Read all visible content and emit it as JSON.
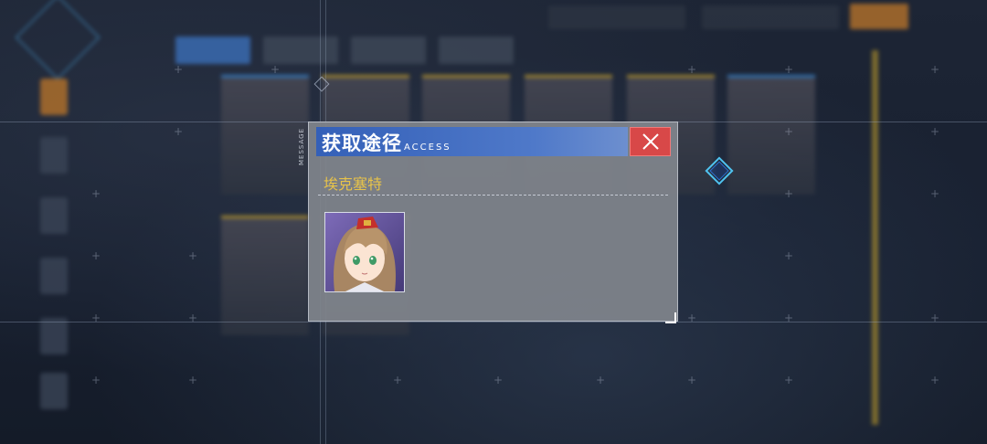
{
  "dialog": {
    "title": "获取途径",
    "subtitle": "ACCESS",
    "item_name": "埃克塞特",
    "side_label": "MESSAGE"
  },
  "icons": {
    "close": "close-icon",
    "portrait": "character-portrait",
    "objective": "diamond-marker-icon"
  },
  "colors": {
    "header_blue": "#3460b8",
    "close_red": "#d84848",
    "item_gold": "#e7c34a"
  }
}
